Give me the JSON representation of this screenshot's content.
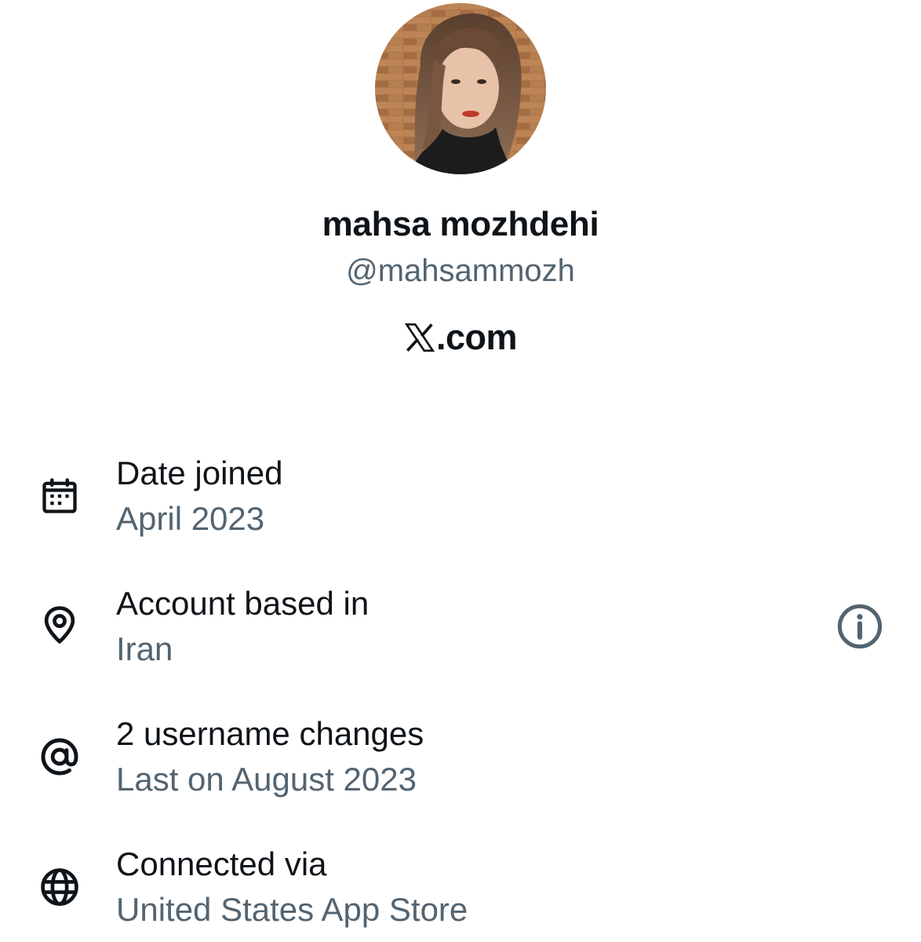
{
  "profile": {
    "display_name": "mahsa mozhdehi",
    "handle": "@mahsammozh",
    "avatar_icon": "profile-photo",
    "brand_logo_icon": "x-logo-icon",
    "brand_text": ".com"
  },
  "about": {
    "rows": [
      {
        "icon": "calendar-icon",
        "title": "Date joined",
        "value": "April 2023"
      },
      {
        "icon": "location-pin-icon",
        "title": "Account based in",
        "value": "Iran",
        "trailing_icon": "info-icon"
      },
      {
        "icon": "at-sign-icon",
        "title": "2 username changes",
        "value": "Last on August 2023"
      },
      {
        "icon": "globe-icon",
        "title": "Connected via",
        "value": "United States App Store"
      }
    ]
  },
  "colors": {
    "primary_text": "#0f1419",
    "secondary_text": "#536471",
    "background": "#ffffff"
  }
}
